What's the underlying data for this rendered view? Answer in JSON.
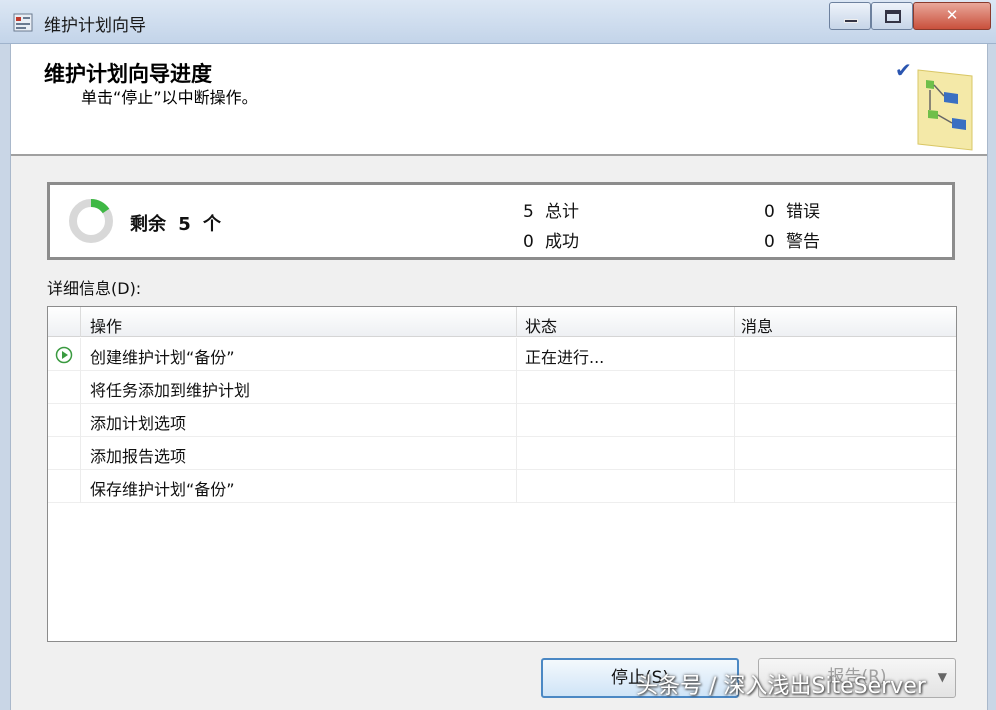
{
  "window": {
    "title": "维护计划向导"
  },
  "header": {
    "title": "维护计划向导进度",
    "subtitle": "单击“停止”以中断操作。"
  },
  "summary": {
    "remaining_label": "剩余 5 个",
    "total": {
      "value": "5",
      "label": "总计"
    },
    "success": {
      "value": "0",
      "label": "成功"
    },
    "error": {
      "value": "0",
      "label": "错误"
    },
    "warning": {
      "value": "0",
      "label": "警告"
    }
  },
  "details": {
    "label": "详细信息(D):",
    "columns": [
      "操作",
      "状态",
      "消息"
    ],
    "rows": [
      {
        "action": "创建维护计划“备份”",
        "status": "正在进行...",
        "message": "",
        "active": true
      },
      {
        "action": "将任务添加到维护计划",
        "status": "",
        "message": ""
      },
      {
        "action": "添加计划选项",
        "status": "",
        "message": ""
      },
      {
        "action": "添加报告选项",
        "status": "",
        "message": ""
      },
      {
        "action": "保存维护计划“备份”",
        "status": "",
        "message": ""
      }
    ]
  },
  "buttons": {
    "stop": "停止(S)",
    "report": "报告(R)"
  },
  "watermark": "头条号 / 深入浅出SiteServer",
  "colors": {
    "accent": "#4b88c4",
    "spinner_active": "#3fb845",
    "spinner_idle": "#d8d8d8"
  }
}
